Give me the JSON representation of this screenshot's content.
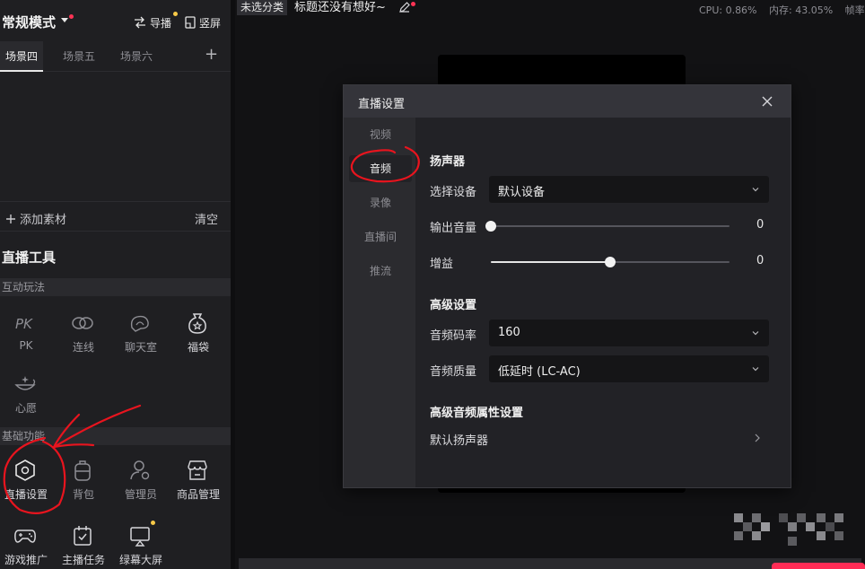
{
  "left_panel": {
    "mode_title": "常规模式",
    "guide_label": "导播",
    "portrait_label": "竖屏",
    "scene_tabs": [
      "场景四",
      "场景五",
      "场景六"
    ],
    "add_material": "添加素材",
    "clear": "清空",
    "tools_title": "直播工具",
    "interactive_section": "互动玩法",
    "interactive_tools": [
      "PK",
      "连线",
      "聊天室",
      "福袋",
      "心愿"
    ],
    "basic_section": "基础功能",
    "basic_tools": [
      "直播设置",
      "背包",
      "管理员",
      "商品管理",
      "游戏推广",
      "主播任务",
      "绿幕大屏"
    ]
  },
  "topbar": {
    "category": "未选分类",
    "stream_title": "标题还没有想好~",
    "cpu": "CPU: 0.86%",
    "memory": "内存: 43.05%",
    "framerate": "帧率"
  },
  "dialog": {
    "title": "直播设置",
    "nav": [
      "视频",
      "音频",
      "录像",
      "直播间",
      "推流"
    ],
    "active_nav": "音频",
    "speaker_section": "扬声器",
    "select_device_label": "选择设备",
    "select_device_value": "默认设备",
    "output_volume_label": "输出音量",
    "output_volume_value": "0",
    "output_volume_level": 0,
    "gain_label": "增益",
    "gain_value": "0",
    "gain_level": 0.5,
    "advanced_section": "高级设置",
    "bitrate_label": "音频码率",
    "bitrate_value": "160",
    "quality_label": "音频质量",
    "quality_value": "低延时 (LC-AC)",
    "advanced_audio_section": "高级音频属性设置",
    "default_speaker": "默认扬声器"
  },
  "colors": {
    "accent_red": "#ff3355",
    "badge_yellow": "#f7c948",
    "annotation_red": "#e8141e"
  }
}
